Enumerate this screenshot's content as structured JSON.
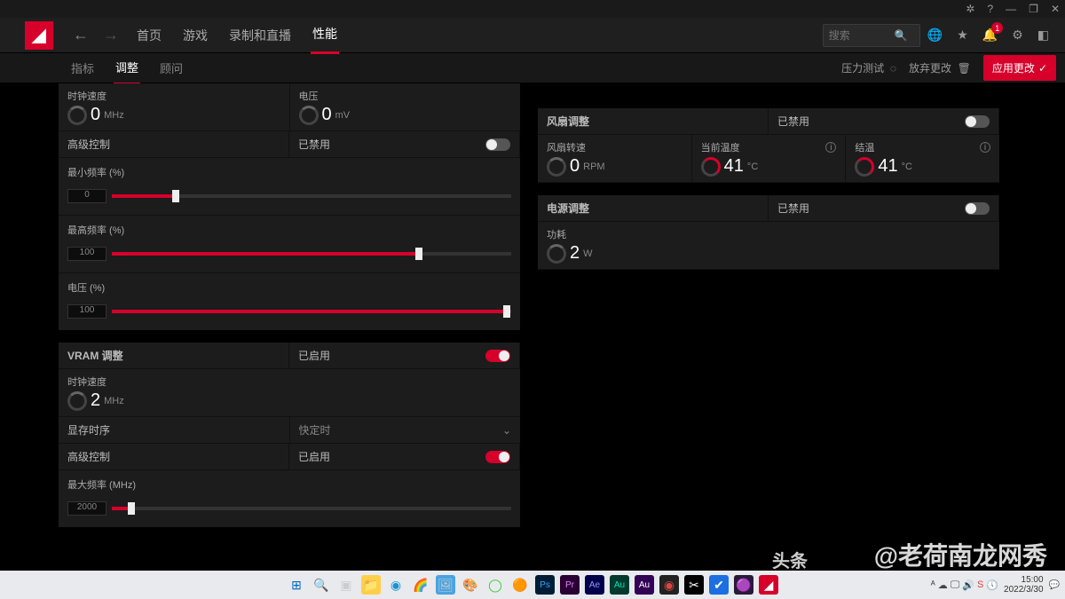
{
  "titlebar": {
    "icons": [
      "⚙",
      "?",
      "—",
      "❐",
      "✕"
    ]
  },
  "topnav": {
    "items": [
      "首页",
      "游戏",
      "录制和直播",
      "性能"
    ],
    "active": 3,
    "search_placeholder": "搜索",
    "bell_count": "1"
  },
  "subnav": {
    "items": [
      "指标",
      "调整",
      "顾问"
    ],
    "active": 1,
    "stress": "压力测试",
    "discard": "放弃更改",
    "apply": "应用更改"
  },
  "left": {
    "clock": {
      "clock_label": "时钟速度",
      "clock_val": "0",
      "clock_unit": "MHz",
      "volt_label": "电压",
      "volt_val": "0",
      "volt_unit": "mV"
    },
    "adv": {
      "label": "高级控制",
      "status": "已禁用"
    },
    "minfreq": {
      "label": "最小频率 (%)",
      "value": "0",
      "pct": 15
    },
    "maxfreq": {
      "label": "最高频率 (%)",
      "value": "100",
      "pct": 76
    },
    "voltpct": {
      "label": "电压 (%)",
      "value": "100",
      "pct": 98
    },
    "vram": {
      "title": "VRAM 调整",
      "status": "已启用"
    },
    "vram_clock": {
      "label": "时钟速度",
      "val": "2",
      "unit": "MHz"
    },
    "memtiming": {
      "label": "显存时序",
      "value": "快定时"
    },
    "vram_adv": {
      "label": "高级控制",
      "status": "已启用"
    },
    "vram_maxfreq": {
      "label": "最大频率 (MHz)",
      "value": "2000",
      "pct": 4
    }
  },
  "right": {
    "fan": {
      "title": "风扇调整",
      "status": "已禁用",
      "speed_label": "风扇转速",
      "speed_val": "0",
      "speed_unit": "RPM",
      "cur_label": "当前温度",
      "cur_val": "41",
      "cur_unit": "°C",
      "jt_label": "结温",
      "jt_val": "41",
      "jt_unit": "°C"
    },
    "power": {
      "title": "电源调整",
      "status": "已禁用",
      "p_label": "功耗",
      "p_val": "2",
      "p_unit": "W"
    }
  },
  "watermark_left": "头条",
  "watermark_right": "@老荷南龙网秀",
  "taskbar": {
    "time": "15:00",
    "date": "2022/3/30"
  }
}
